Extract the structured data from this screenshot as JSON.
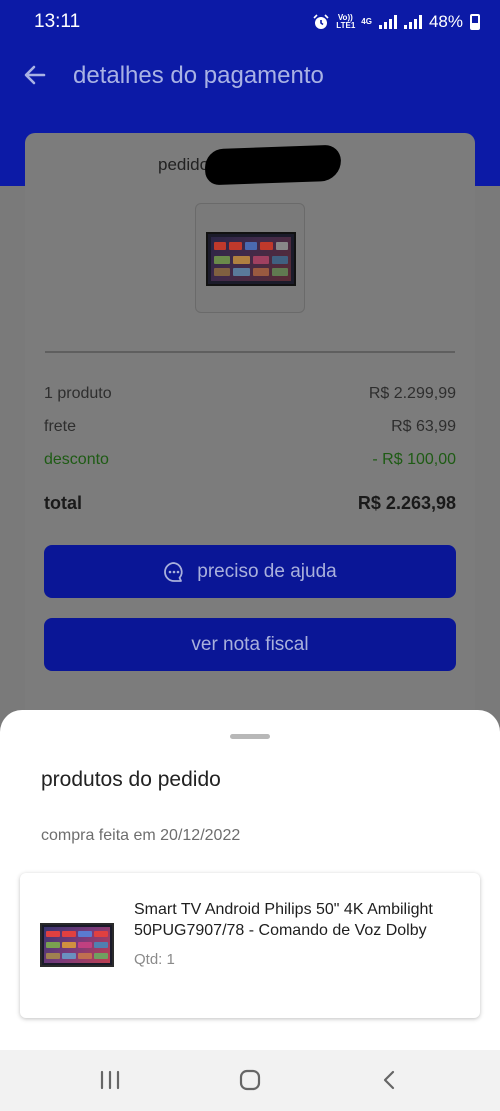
{
  "status_bar": {
    "time": "13:11",
    "volte": "Vo)) LTE1",
    "network": "4G",
    "battery": "48%"
  },
  "header": {
    "title": "detalhes do pagamento"
  },
  "order": {
    "label": "pedido"
  },
  "summary": {
    "products_label": "1 produto",
    "products_value": "R$ 2.299,99",
    "shipping_label": "frete",
    "shipping_value": "R$ 63,99",
    "discount_label": "desconto",
    "discount_value": "- R$ 100,00",
    "total_label": "total",
    "total_value": "R$ 2.263,98"
  },
  "buttons": {
    "help": "preciso de ajuda",
    "invoice": "ver nota fiscal"
  },
  "sheet": {
    "title": "produtos do pedido",
    "purchase_date": "compra feita em 20/12/2022",
    "product": {
      "name": "Smart TV Android Philips 50\" 4K Ambilight 50PUG7907/78 - Comando de Voz Dolby",
      "quantity": "Qtd: 1"
    }
  },
  "colors": {
    "brand_blue": "#0c1aa6",
    "discount_green": "#1e5b14"
  },
  "icons": [
    "back-arrow-icon",
    "chat-icon",
    "recents-icon",
    "home-icon",
    "nav-back-icon"
  ]
}
